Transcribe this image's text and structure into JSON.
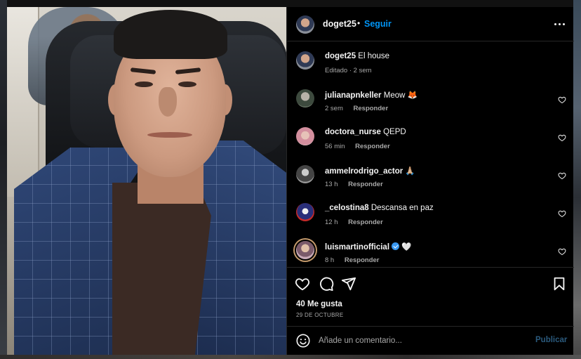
{
  "header": {
    "username": "doget25",
    "separator": "•",
    "follow_label": "Seguir"
  },
  "caption": {
    "username": "doget25",
    "text": "El house",
    "meta": "Editado · 2 sem"
  },
  "comments": [
    {
      "username": "julianapnkeller",
      "text": "Meow 🦊",
      "time": "2 sem",
      "reply_label": "Responder",
      "verified": false
    },
    {
      "username": "doctora_nurse",
      "text": "QEPD",
      "time": "56 min",
      "reply_label": "Responder",
      "verified": false
    },
    {
      "username": "ammelrodrigo_actor",
      "text": "🙏🏼",
      "time": "13 h",
      "reply_label": "Responder",
      "verified": false
    },
    {
      "username": "_celostina8",
      "text": "Descansa en paz",
      "time": "12 h",
      "reply_label": "Responder",
      "verified": false
    },
    {
      "username": "luismartinofficial",
      "text": "🤍",
      "time": "8 h",
      "reply_label": "Responder",
      "verified": true
    }
  ],
  "actions": {
    "likes": "40 Me gusta",
    "date": "29 DE OCTUBRE"
  },
  "composer": {
    "placeholder": "Añade un comentario...",
    "publish_label": "Publicar"
  },
  "colors": {
    "accent": "#0095f6",
    "publish_disabled": "#2b5a7d",
    "panel_bg": "#000000",
    "muted_text": "#a8a8a8",
    "verified": "#3897f0"
  },
  "icons": [
    "more-icon",
    "heart-icon",
    "comment-icon",
    "share-icon",
    "bookmark-icon",
    "emoji-icon",
    "verified-badge-icon"
  ]
}
